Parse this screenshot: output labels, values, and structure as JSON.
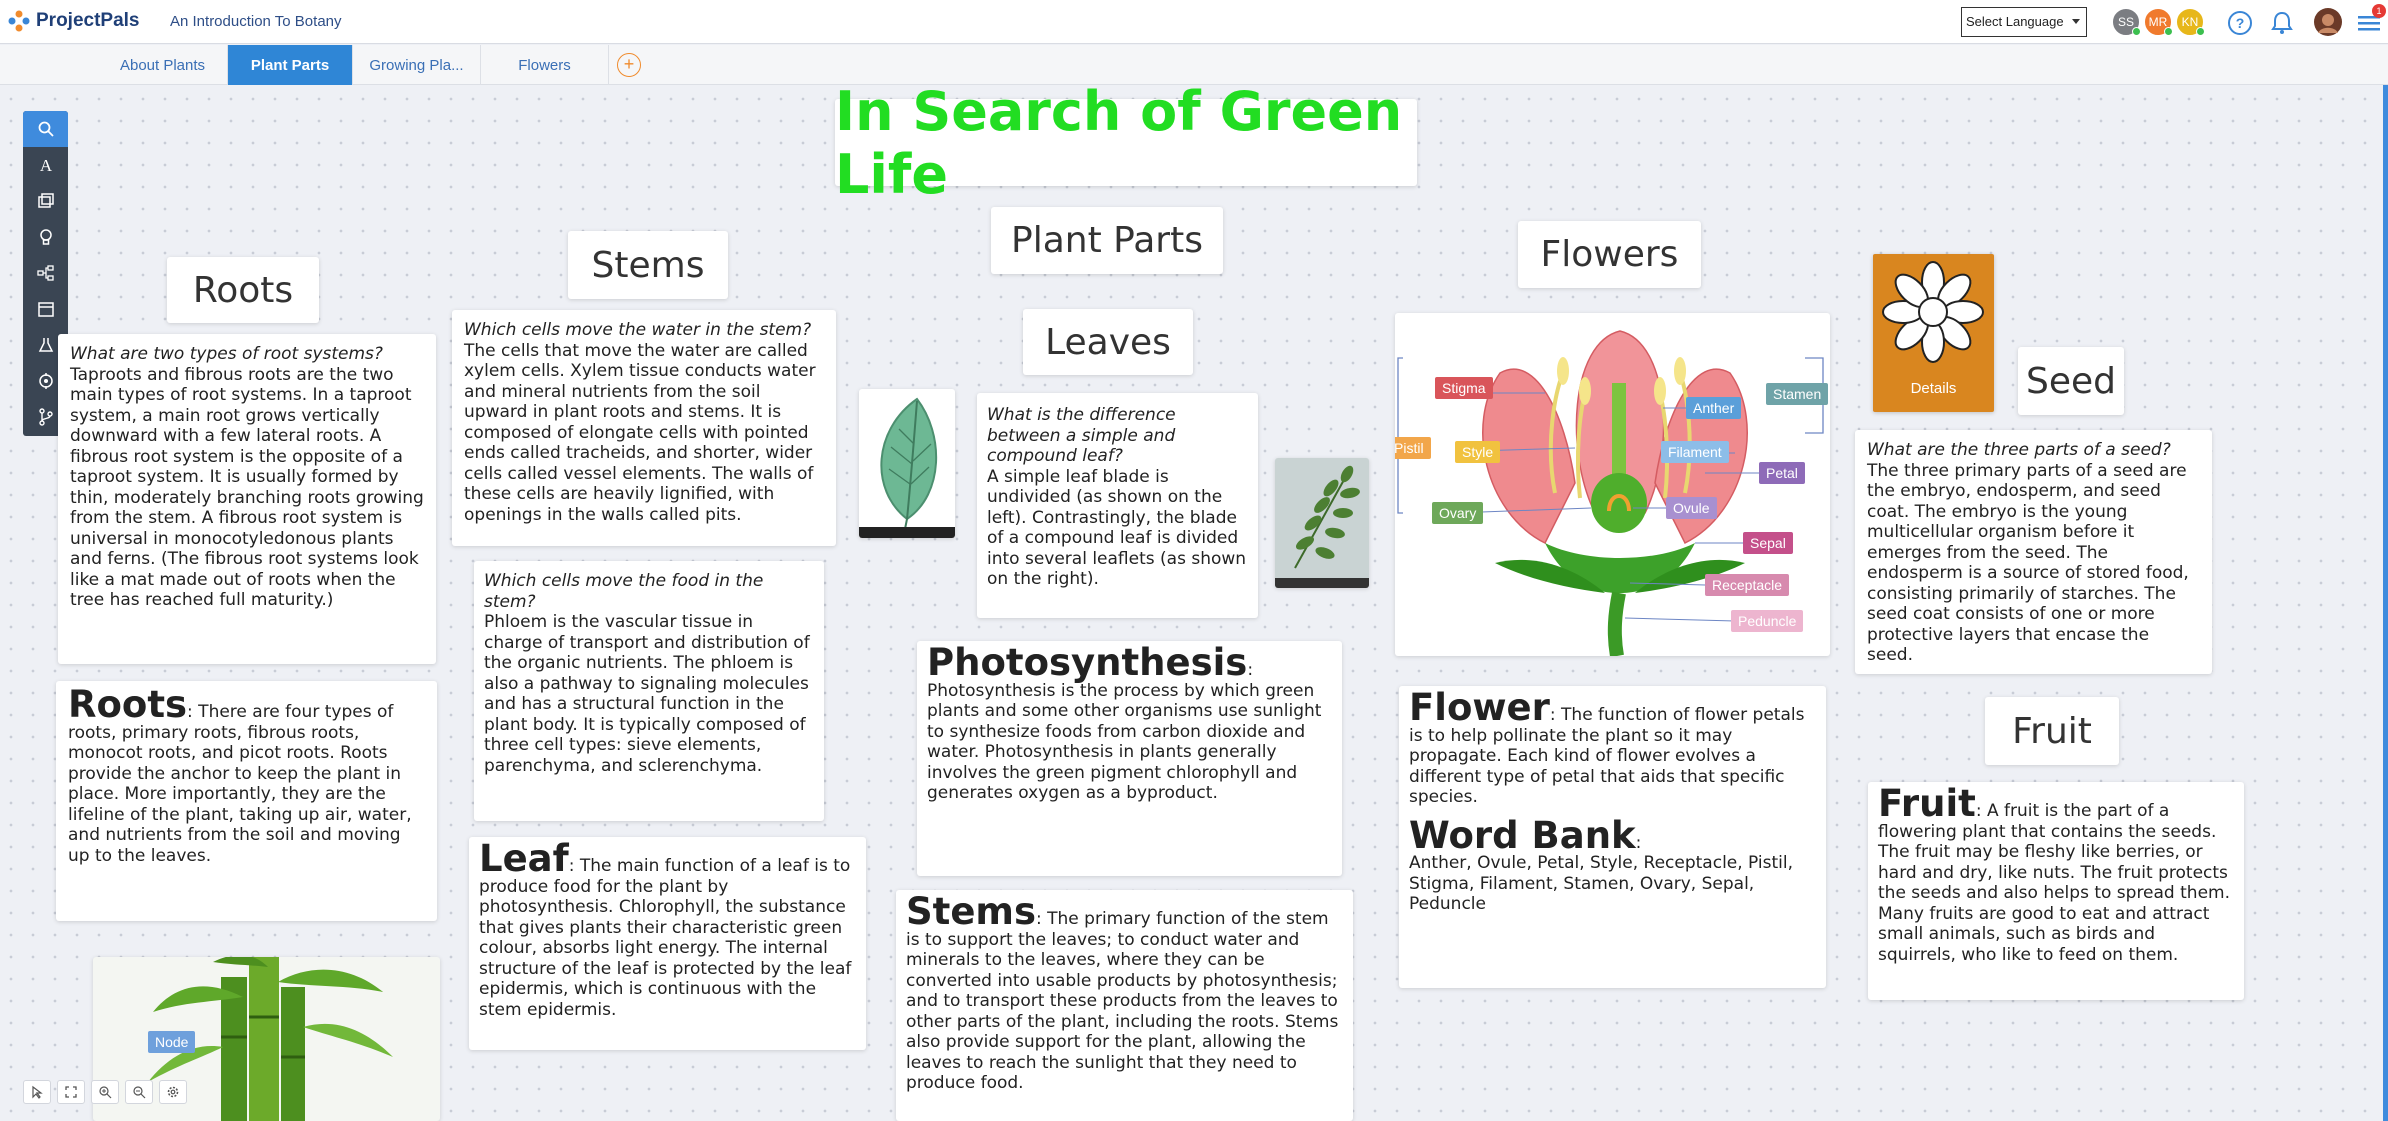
{
  "app": {
    "name": "ProjectPals",
    "course_title": "An Introduction To Botany"
  },
  "header": {
    "language_label": "Select Language",
    "avatars": [
      {
        "initials": "SS",
        "color": "#7b7d82"
      },
      {
        "initials": "MR",
        "color": "#f07a2d"
      },
      {
        "initials": "KN",
        "color": "#e7b71a"
      }
    ],
    "notification_badge": "1"
  },
  "tabs": [
    "About Plants",
    "Plant Parts",
    "Growing Pla...",
    "Flowers"
  ],
  "tabs_add": "+",
  "toolbar": {
    "icons": [
      "search-icon",
      "text-icon",
      "cards-icon",
      "bulb-icon",
      "diagram-icon",
      "calendar-icon",
      "flask-icon",
      "target-icon",
      "branch-icon"
    ]
  },
  "board": {
    "title": "In Search of Green Life",
    "headers": {
      "roots": "Roots",
      "stems": "Stems",
      "plant_parts": "Plant Parts",
      "leaves": "Leaves",
      "flowers": "Flowers",
      "seed": "Seed",
      "fruit": "Fruit"
    },
    "roots_qa": {
      "question": "What are two types of root systems?",
      "answer": "Taproots and fibrous roots are the two main types of root systems. In a taproot system, a main root grows vertically downward with a few lateral roots. A fibrous root system is the opposite of a taproot system. It is usually formed by thin, moderately branching roots growing from the stem. A fibrous root system is universal in monocotyledonous plants and ferns. (The fibrous root systems look like a mat made out of roots when the tree has reached full maturity.)"
    },
    "roots_def": {
      "term": "Roots",
      "text": ": There are four types of roots, primary roots, fibrous roots, monocot roots, and picot roots. Roots provide the anchor to keep the plant in place. More importantly, they are the lifeline of the plant, taking up air, water, and nutrients from the soil and moving up to the leaves."
    },
    "stems_qa1": {
      "question": "Which cells move the water in the stem?",
      "answer": "The cells that move the water are called xylem cells. Xylem tissue conducts water and mineral nutrients from the soil upward in plant roots and stems. It is composed of elongate cells with pointed ends called tracheids, and shorter, wider cells called vessel elements. The walls of these cells are heavily lignified, with openings in the walls called pits."
    },
    "stems_qa2": {
      "question": "Which cells move the food in the stem?",
      "answer": "Phloem is the vascular tissue in charge of transport and distribution of the organic nutrients. The phloem is also a pathway to signaling molecules and has a structural function in the plant body. It is typically composed of three cell types: sieve elements, parenchyma, and sclerenchyma."
    },
    "leaf_def": {
      "term": "Leaf",
      "text": ": The main function of a leaf is to produce food for the plant by photosynthesis. Chlorophyll, the substance that gives plants their characteristic green colour, absorbs light energy. The internal structure of the leaf is protected by the leaf epidermis, which is continuous with the stem epidermis."
    },
    "leaves_qa": {
      "question": "What is the difference between a simple and compound leaf?",
      "answer": "A simple leaf blade is undivided (as shown on the left). Contrastingly, the blade of a compound leaf is divided into several leaflets (as shown on the right)."
    },
    "photosynthesis_def": {
      "term": "Photosynthesis",
      "text": ": Photosynthesis is the process by which green plants and some other organisms use sunlight to synthesize foods from carbon dioxide and water. Photosynthesis in plants generally involves the green pigment chlorophyll and generates oxygen as a byproduct."
    },
    "stems_def": {
      "term": "Stems",
      "text": ": The primary function of the stem is to support the leaves; to conduct water and minerals to the leaves, where they can be converted into usable products by photosynthesis; and to transport these products from the leaves to other parts of the plant, including the roots. Stems also provide support for the plant, allowing the leaves to reach the sunlight that they need to produce food."
    },
    "flower_diagram_labels": [
      "Stigma",
      "Anther",
      "Stamen",
      "Pistil",
      "Style",
      "Filament",
      "Petal",
      "Ovary",
      "Ovule",
      "Sepal",
      "Receptacle",
      "Peduncle"
    ],
    "flower_def": {
      "term": "Flower",
      "text": ": The function of flower petals is to help pollinate the plant so it may propagate. Each kind of flower evolves a different type of petal that aids that specific species."
    },
    "word_bank": {
      "term": "Word Bank",
      "text": ":",
      "words": "Anther, Ovule, Petal, Style, Receptacle, Pistil, Stigma, Filament, Stamen, Ovary, Sepal, Peduncle"
    },
    "details_label": "Details",
    "seed_qa": {
      "question": "What are the three parts of a seed?",
      "answer": "The three primary parts of a seed are the embryo, endosperm, and seed coat. The embryo is the young multicellular organism before it emerges from the seed. The endosperm is a source of stored food, consisting primarily of starches. The seed coat consists of one or more protective layers that encase the seed."
    },
    "fruit_def": {
      "term": "Fruit",
      "text": ": A fruit is the part of a flowering plant that contains the seeds. The fruit may be fleshy like berries, or hard and dry, like nuts. The fruit protects the seeds and also helps to spread them. Many fruits are good to eat and attract small animals, such as birds and squirrels, who like to feed on them."
    },
    "node_label": "Node"
  },
  "colors": {
    "title_green": "#22dd22",
    "tab_active": "#2f86d6",
    "toolbar_bg": "#3a4553",
    "details_orange": "#d9861f"
  }
}
